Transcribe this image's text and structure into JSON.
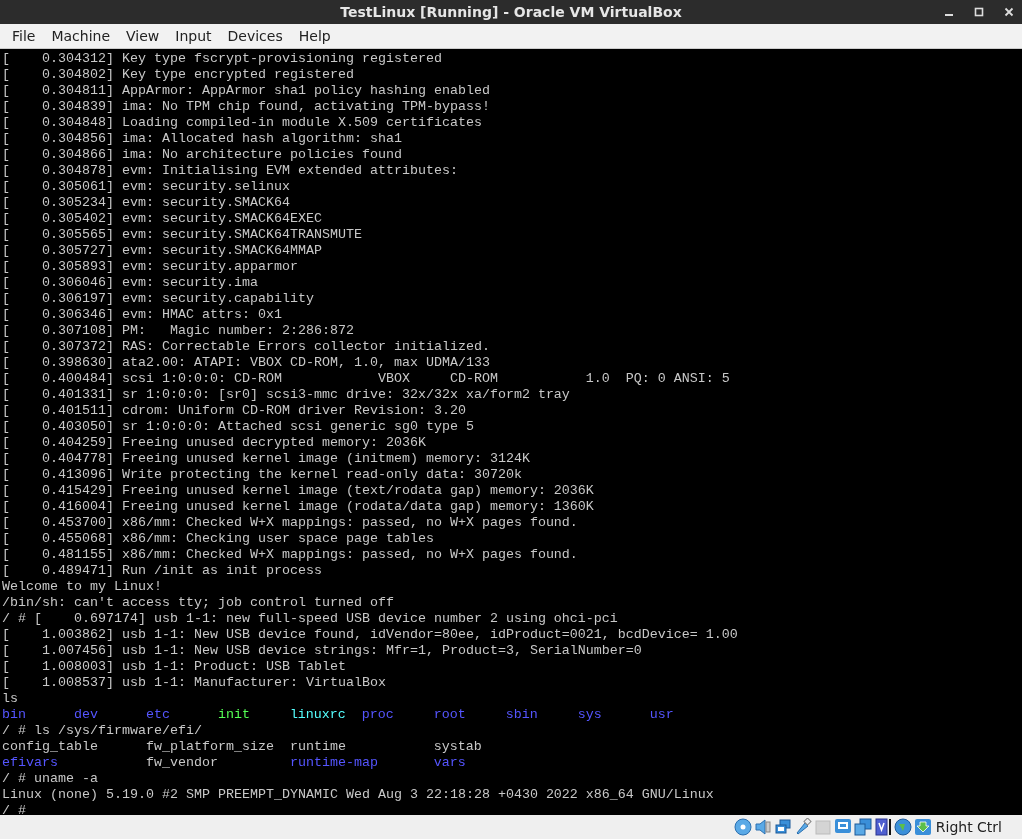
{
  "window": {
    "title": "TestLinux [Running] - Oracle VM VirtualBox"
  },
  "menu": [
    "File",
    "Machine",
    "View",
    "Input",
    "Devices",
    "Help"
  ],
  "console": [
    {
      "kind": "text",
      "text": "[    0.304312] Key type fscrypt-provisioning registered"
    },
    {
      "kind": "text",
      "text": "[    0.304802] Key type encrypted registered"
    },
    {
      "kind": "text",
      "text": "[    0.304811] AppArmor: AppArmor sha1 policy hashing enabled"
    },
    {
      "kind": "text",
      "text": "[    0.304839] ima: No TPM chip found, activating TPM-bypass!"
    },
    {
      "kind": "text",
      "text": "[    0.304848] Loading compiled-in module X.509 certificates"
    },
    {
      "kind": "text",
      "text": "[    0.304856] ima: Allocated hash algorithm: sha1"
    },
    {
      "kind": "text",
      "text": "[    0.304866] ima: No architecture policies found"
    },
    {
      "kind": "text",
      "text": "[    0.304878] evm: Initialising EVM extended attributes:"
    },
    {
      "kind": "text",
      "text": "[    0.305061] evm: security.selinux"
    },
    {
      "kind": "text",
      "text": "[    0.305234] evm: security.SMACK64"
    },
    {
      "kind": "text",
      "text": "[    0.305402] evm: security.SMACK64EXEC"
    },
    {
      "kind": "text",
      "text": "[    0.305565] evm: security.SMACK64TRANSMUTE"
    },
    {
      "kind": "text",
      "text": "[    0.305727] evm: security.SMACK64MMAP"
    },
    {
      "kind": "text",
      "text": "[    0.305893] evm: security.apparmor"
    },
    {
      "kind": "text",
      "text": "[    0.306046] evm: security.ima"
    },
    {
      "kind": "text",
      "text": "[    0.306197] evm: security.capability"
    },
    {
      "kind": "text",
      "text": "[    0.306346] evm: HMAC attrs: 0x1"
    },
    {
      "kind": "text",
      "text": "[    0.307108] PM:   Magic number: 2:286:872"
    },
    {
      "kind": "text",
      "text": "[    0.307372] RAS: Correctable Errors collector initialized."
    },
    {
      "kind": "text",
      "text": "[    0.398630] ata2.00: ATAPI: VBOX CD-ROM, 1.0, max UDMA/133"
    },
    {
      "kind": "text",
      "text": "[    0.400484] scsi 1:0:0:0: CD-ROM            VBOX     CD-ROM           1.0  PQ: 0 ANSI: 5"
    },
    {
      "kind": "text",
      "text": "[    0.401331] sr 1:0:0:0: [sr0] scsi3-mmc drive: 32x/32x xa/form2 tray"
    },
    {
      "kind": "text",
      "text": "[    0.401511] cdrom: Uniform CD-ROM driver Revision: 3.20"
    },
    {
      "kind": "text",
      "text": "[    0.403050] sr 1:0:0:0: Attached scsi generic sg0 type 5"
    },
    {
      "kind": "text",
      "text": "[    0.404259] Freeing unused decrypted memory: 2036K"
    },
    {
      "kind": "text",
      "text": "[    0.404778] Freeing unused kernel image (initmem) memory: 3124K"
    },
    {
      "kind": "text",
      "text": "[    0.413096] Write protecting the kernel read-only data: 30720k"
    },
    {
      "kind": "text",
      "text": "[    0.415429] Freeing unused kernel image (text/rodata gap) memory: 2036K"
    },
    {
      "kind": "text",
      "text": "[    0.416004] Freeing unused kernel image (rodata/data gap) memory: 1360K"
    },
    {
      "kind": "text",
      "text": "[    0.453700] x86/mm: Checked W+X mappings: passed, no W+X pages found."
    },
    {
      "kind": "text",
      "text": "[    0.455068] x86/mm: Checking user space page tables"
    },
    {
      "kind": "text",
      "text": "[    0.481155] x86/mm: Checked W+X mappings: passed, no W+X pages found."
    },
    {
      "kind": "text",
      "text": "[    0.489471] Run /init as init process"
    },
    {
      "kind": "text",
      "text": "Welcome to my Linux!"
    },
    {
      "kind": "text",
      "text": "/bin/sh: can't access tty; job control turned off"
    },
    {
      "kind": "text",
      "text": "/ # [    0.697174] usb 1-1: new full-speed USB device number 2 using ohci-pci"
    },
    {
      "kind": "text",
      "text": "[    1.003862] usb 1-1: New USB device found, idVendor=80ee, idProduct=0021, bcdDevice= 1.00"
    },
    {
      "kind": "text",
      "text": "[    1.007456] usb 1-1: New USB device strings: Mfr=1, Product=3, SerialNumber=0"
    },
    {
      "kind": "text",
      "text": "[    1.008003] usb 1-1: Product: USB Tablet"
    },
    {
      "kind": "text",
      "text": "[    1.008537] usb 1-1: Manufacturer: VirtualBox"
    },
    {
      "kind": "text",
      "text": "ls"
    },
    {
      "kind": "listing",
      "rows": [
        [
          {
            "text": "bin",
            "color": "#5555ff"
          },
          {
            "text": "dev",
            "color": "#5555ff"
          },
          {
            "text": "etc",
            "color": "#5555ff"
          },
          {
            "text": "init",
            "color": "#55ff55"
          },
          {
            "text": "linuxrc",
            "color": "#55ffff"
          },
          {
            "text": "proc",
            "color": "#5555ff"
          },
          {
            "text": "root",
            "color": "#5555ff"
          },
          {
            "text": "sbin",
            "color": "#5555ff"
          },
          {
            "text": "sys",
            "color": "#5555ff"
          },
          {
            "text": "usr",
            "color": "#5555ff"
          }
        ]
      ]
    },
    {
      "kind": "text",
      "text": "/ # ls /sys/firmware/efi/"
    },
    {
      "kind": "listing",
      "rows": [
        [
          {
            "text": "config_table",
            "color": "#c8c8c8"
          },
          {
            "text": "fw_platform_size",
            "color": "#c8c8c8"
          },
          {
            "text": "runtime",
            "color": "#c8c8c8"
          },
          {
            "text": "systab",
            "color": "#c8c8c8"
          }
        ],
        [
          {
            "text": "efivars",
            "color": "#5555ff"
          },
          {
            "text": "fw_vendor",
            "color": "#c8c8c8"
          },
          {
            "text": "runtime-map",
            "color": "#5555ff"
          },
          {
            "text": "vars",
            "color": "#5555ff"
          }
        ]
      ]
    },
    {
      "kind": "text",
      "text": "/ # uname -a"
    },
    {
      "kind": "text",
      "text": "Linux (none) 5.19.0 #2 SMP PREEMPT_DYNAMIC Wed Aug 3 22:18:28 +0430 2022 x86_64 GNU/Linux"
    },
    {
      "kind": "text",
      "text": "/ #"
    }
  ],
  "status_bar": {
    "host_key": "Right Ctrl"
  }
}
